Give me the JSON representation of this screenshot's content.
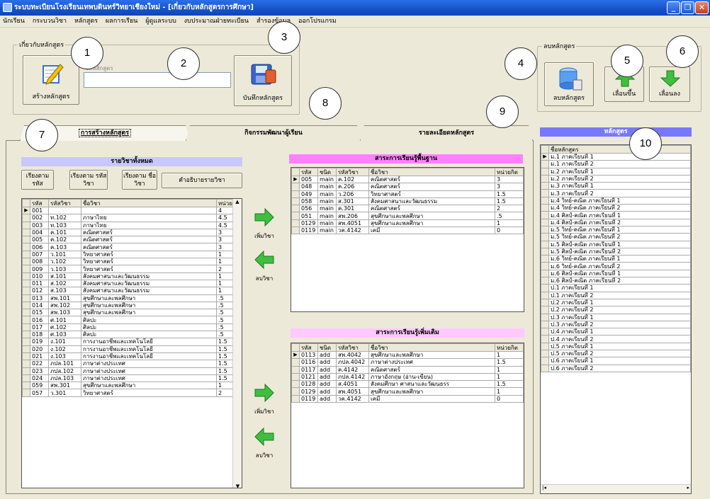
{
  "window": {
    "title": "ระบบทะเบียนโรงเรียนเทพบดินทร์วิทยาเชียงใหม่ - [เกี่ยวกับหลักสูตรการศึกษา]"
  },
  "menu": [
    "นักเรียน",
    "กระบวนวิชา",
    "หลักสูตร",
    "ผลการเรียน",
    "ผู้ดูแลระบบ",
    "งบประมาณฝ่ายทะเบียน",
    "สำรองข้อมูล",
    "ออกโปรแกรม"
  ],
  "groups": {
    "about": "เกี่ยวกับหลักสูตร",
    "delete": "ลบหลักสูตร"
  },
  "buttons": {
    "create": "สร้างหลักสูตร",
    "save": "บันทึกหลักสูตร",
    "delete": "ลบหลักสูตร",
    "move_up": "เลื่อนขึ้น",
    "move_down": "เลื่อนลง",
    "add_subject": "เพิ่มวิชา",
    "remove_subject": "ลบวิชา",
    "sort_code": "เรียงตาม รหัส",
    "sort_subject_code": "เรียงตาม รหัสวิชา",
    "sort_subject_name": "เรียงตาม ชื่อวิชา",
    "describe": "คำอธิบายรายวิชา"
  },
  "course_name_field": {
    "label": "ชื่อหลักสูตร",
    "value": ""
  },
  "callouts": [
    "1",
    "2",
    "3",
    "4",
    "5",
    "6",
    "7",
    "8",
    "9",
    "10"
  ],
  "tabs": [
    "การสร้างหลักสูตร",
    "กิจกรรมพัฒนาผู้เรียน",
    "รายละเอียดหลักสูตร"
  ],
  "all_subjects": {
    "title": "รายวิชาทั้งหมด",
    "columns": [
      "รหัส",
      "รหัสวิชา",
      "ชื่อวิชา",
      "หน่วยกิต"
    ],
    "rows": [
      [
        "001",
        "",
        "",
        "4"
      ],
      [
        "002",
        "ท.102",
        "ภาษาไทย",
        "4.5"
      ],
      [
        "003",
        "ท.103",
        "ภาษาไทย",
        "4.5"
      ],
      [
        "004",
        "ค.101",
        "คณิตศาสตร์",
        "3"
      ],
      [
        "005",
        "ค.102",
        "คณิตศาสตร์",
        "3"
      ],
      [
        "006",
        "ค.103",
        "คณิตศาสตร์",
        "3"
      ],
      [
        "007",
        "ว.101",
        "วิทยาศาสตร์",
        "1"
      ],
      [
        "008",
        "ว.102",
        "วิทยาศาสตร์",
        "1"
      ],
      [
        "009",
        "ว.103",
        "วิทยาศาสตร์",
        "2"
      ],
      [
        "010",
        "ส.101",
        "สังคมศาสนาและวัฒนธรรม",
        "1"
      ],
      [
        "011",
        "ส.102",
        "สังคมศาสนาและวัฒนธรรม",
        "1"
      ],
      [
        "012",
        "ส.103",
        "สังคมศาสนาและวัฒนธรรม",
        "1"
      ],
      [
        "013",
        "สพ.101",
        "สุขศึกษาและพลศึกษา",
        ".5"
      ],
      [
        "014",
        "สพ.102",
        "สุขศึกษาและพลศึกษา",
        ".5"
      ],
      [
        "015",
        "สพ.103",
        "สุขศึกษาและพลศึกษา",
        ".5"
      ],
      [
        "016",
        "ศ.101",
        "ศิลปะ",
        ".5"
      ],
      [
        "017",
        "ศ.102",
        "ศิลปะ",
        ".5"
      ],
      [
        "018",
        "ศ.103",
        "ศิลปะ",
        ".5"
      ],
      [
        "019",
        "ง.101",
        "การงานอาชีพและเทคโนโลยี",
        "1.5"
      ],
      [
        "020",
        "ง.102",
        "การงานอาชีพและเทคโนโลยี",
        "1.5"
      ],
      [
        "021",
        "ง.103",
        "การงานอาชีพและเทคโนโลยี",
        "1.5"
      ],
      [
        "022",
        "ภปล.101",
        "ภาษาต่างประเทศ",
        "1.5"
      ],
      [
        "023",
        "ภปล.102",
        "ภาษาต่างประเทศ",
        "1.5"
      ],
      [
        "024",
        "ภปล.103",
        "ภาษาต่างประเทศ",
        "1.5"
      ],
      [
        "059",
        "สพ.301",
        "สุขศึกษาและพลศึกษา",
        "1"
      ],
      [
        "057",
        "ว.301",
        "วิทยาศาสตร์",
        "2"
      ]
    ]
  },
  "core_subjects": {
    "title": "สาระการเรียนรู้พื้นฐาน",
    "columns": [
      "รหัส",
      "ชนิด",
      "รหัสวิชา",
      "ชื่อวิชา",
      "หน่วยกิต"
    ],
    "rows": [
      [
        "005",
        "main",
        "ค.102",
        "คณิตศาสตร์",
        "3"
      ],
      [
        "048",
        "main",
        "ค.206",
        "คณิตศาสตร์",
        "3"
      ],
      [
        "049",
        "main",
        "ว.206",
        "วิทยาศาสตร์",
        "1.5"
      ],
      [
        "058",
        "main",
        "ส.301",
        "สังคมศาสนาและวัฒนธรรม",
        "1.5"
      ],
      [
        "056",
        "main",
        "ค.301",
        "คณิตศาสตร์",
        "2"
      ],
      [
        "051",
        "main",
        "สพ.206",
        "สุขศึกษาและพลศึกษา",
        ".5"
      ],
      [
        "0129",
        "main",
        "สพ.4051",
        "สุขศึกษาและพลศึกษา",
        "1"
      ],
      [
        "0119",
        "main",
        "วค.4142",
        "เคมี",
        "0"
      ]
    ]
  },
  "extra_subjects": {
    "title": "สาระการเรียนรู้เพิ่มเติม",
    "columns": [
      "รหัส",
      "ชนิด",
      "รหัสวิชา",
      "ชื่อวิชา",
      "หน่วยกิต"
    ],
    "rows": [
      [
        "0113",
        "add",
        "สพ.4042",
        "สุขศึกษาและพลศึกษา",
        "1"
      ],
      [
        "0116",
        "add",
        "ภปล.4042",
        "ภาษาต่างประเทศ",
        "1.5"
      ],
      [
        "0117",
        "add",
        "ค.4142",
        "คณิตศาสตร์",
        "1"
      ],
      [
        "0121",
        "add",
        "ภปล.4142",
        "ภาษาอังกฤษ (อ่าน-เขียน)",
        "1"
      ],
      [
        "0128",
        "add",
        "ส.4051",
        "สังคมศึกษา ศาสนาและวัฒนธรร",
        "1.5"
      ],
      [
        "0129",
        "add",
        "สพ.4051",
        "สุขศึกษาและพลศึกษา",
        "1"
      ],
      [
        "0119",
        "add",
        "วค.4142",
        "เคมี",
        "0"
      ]
    ]
  },
  "curricula": {
    "title": "หลักสูตร",
    "column": "ชื่อหลักสูตร",
    "rows": [
      "ม.1 ภาคเรียนที่ 1",
      "ม.1 ภาคเรียนที่ 2",
      "ม.2 ภาคเรียนที่ 1",
      "ม.2 ภาคเรียนที่ 2",
      "ม.3 ภาคเรียนที่ 1",
      "ม.3 ภาคเรียนที่ 2",
      "ม.4 วิทย์-คณิต ภาคเรียนที่ 1",
      "ม.4 วิทย์-คณิต ภาคเรียนที่ 2",
      "ม.4 ศิลป์-คณิต ภาคเรียนที่ 1",
      "ม.4 ศิลป์-คณิต ภาคเรียนที่ 2",
      "ม.5 วิทย์-คณิต ภาคเรียนที่ 1",
      "ม.5 วิทย์-คณิต ภาคเรียนที่ 2",
      "ม.5 ศิลป์-คณิต ภาคเรียนที่ 1",
      "ม.5 ศิลป์-คณิต ภาคเรียนที่ 2",
      "ม.6 วิทย์-คณิต ภาคเรียนที่ 1",
      "ม.6 วิทย์-คณิต ภาคเรียนที่ 2",
      "ม.6 ศิลป์-คณิต ภาคเรียนที่ 1",
      "ม.6 ศิลป์-คณิต ภาคเรียนที่ 2",
      "ป.1 ภาคเรียนที่ 1",
      "ป.1 ภาคเรียนที่ 2",
      "ป.2 ภาคเรียนที่ 1",
      "ป.2 ภาคเรียนที่ 2",
      "ป.3 ภาคเรียนที่ 1",
      "ป.3 ภาคเรียนที่ 2",
      "ป.4 ภาคเรียนที่ 1",
      "ป.4 ภาคเรียนที่ 2",
      "ป.5 ภาคเรียนที่ 1",
      "ป.5 ภาคเรียนที่ 2",
      "ป.6 ภาคเรียนที่ 1",
      "ป.6 ภาคเรียนที่ 2"
    ]
  },
  "colors": {
    "title_blue": "#1552c9",
    "header_blue": "#c8c8ff",
    "header_pink": "#ff80ff",
    "header_pink_light": "#ffc8ff",
    "curr_header": "#7878ff",
    "arrow_green": "#3fbf3f"
  }
}
